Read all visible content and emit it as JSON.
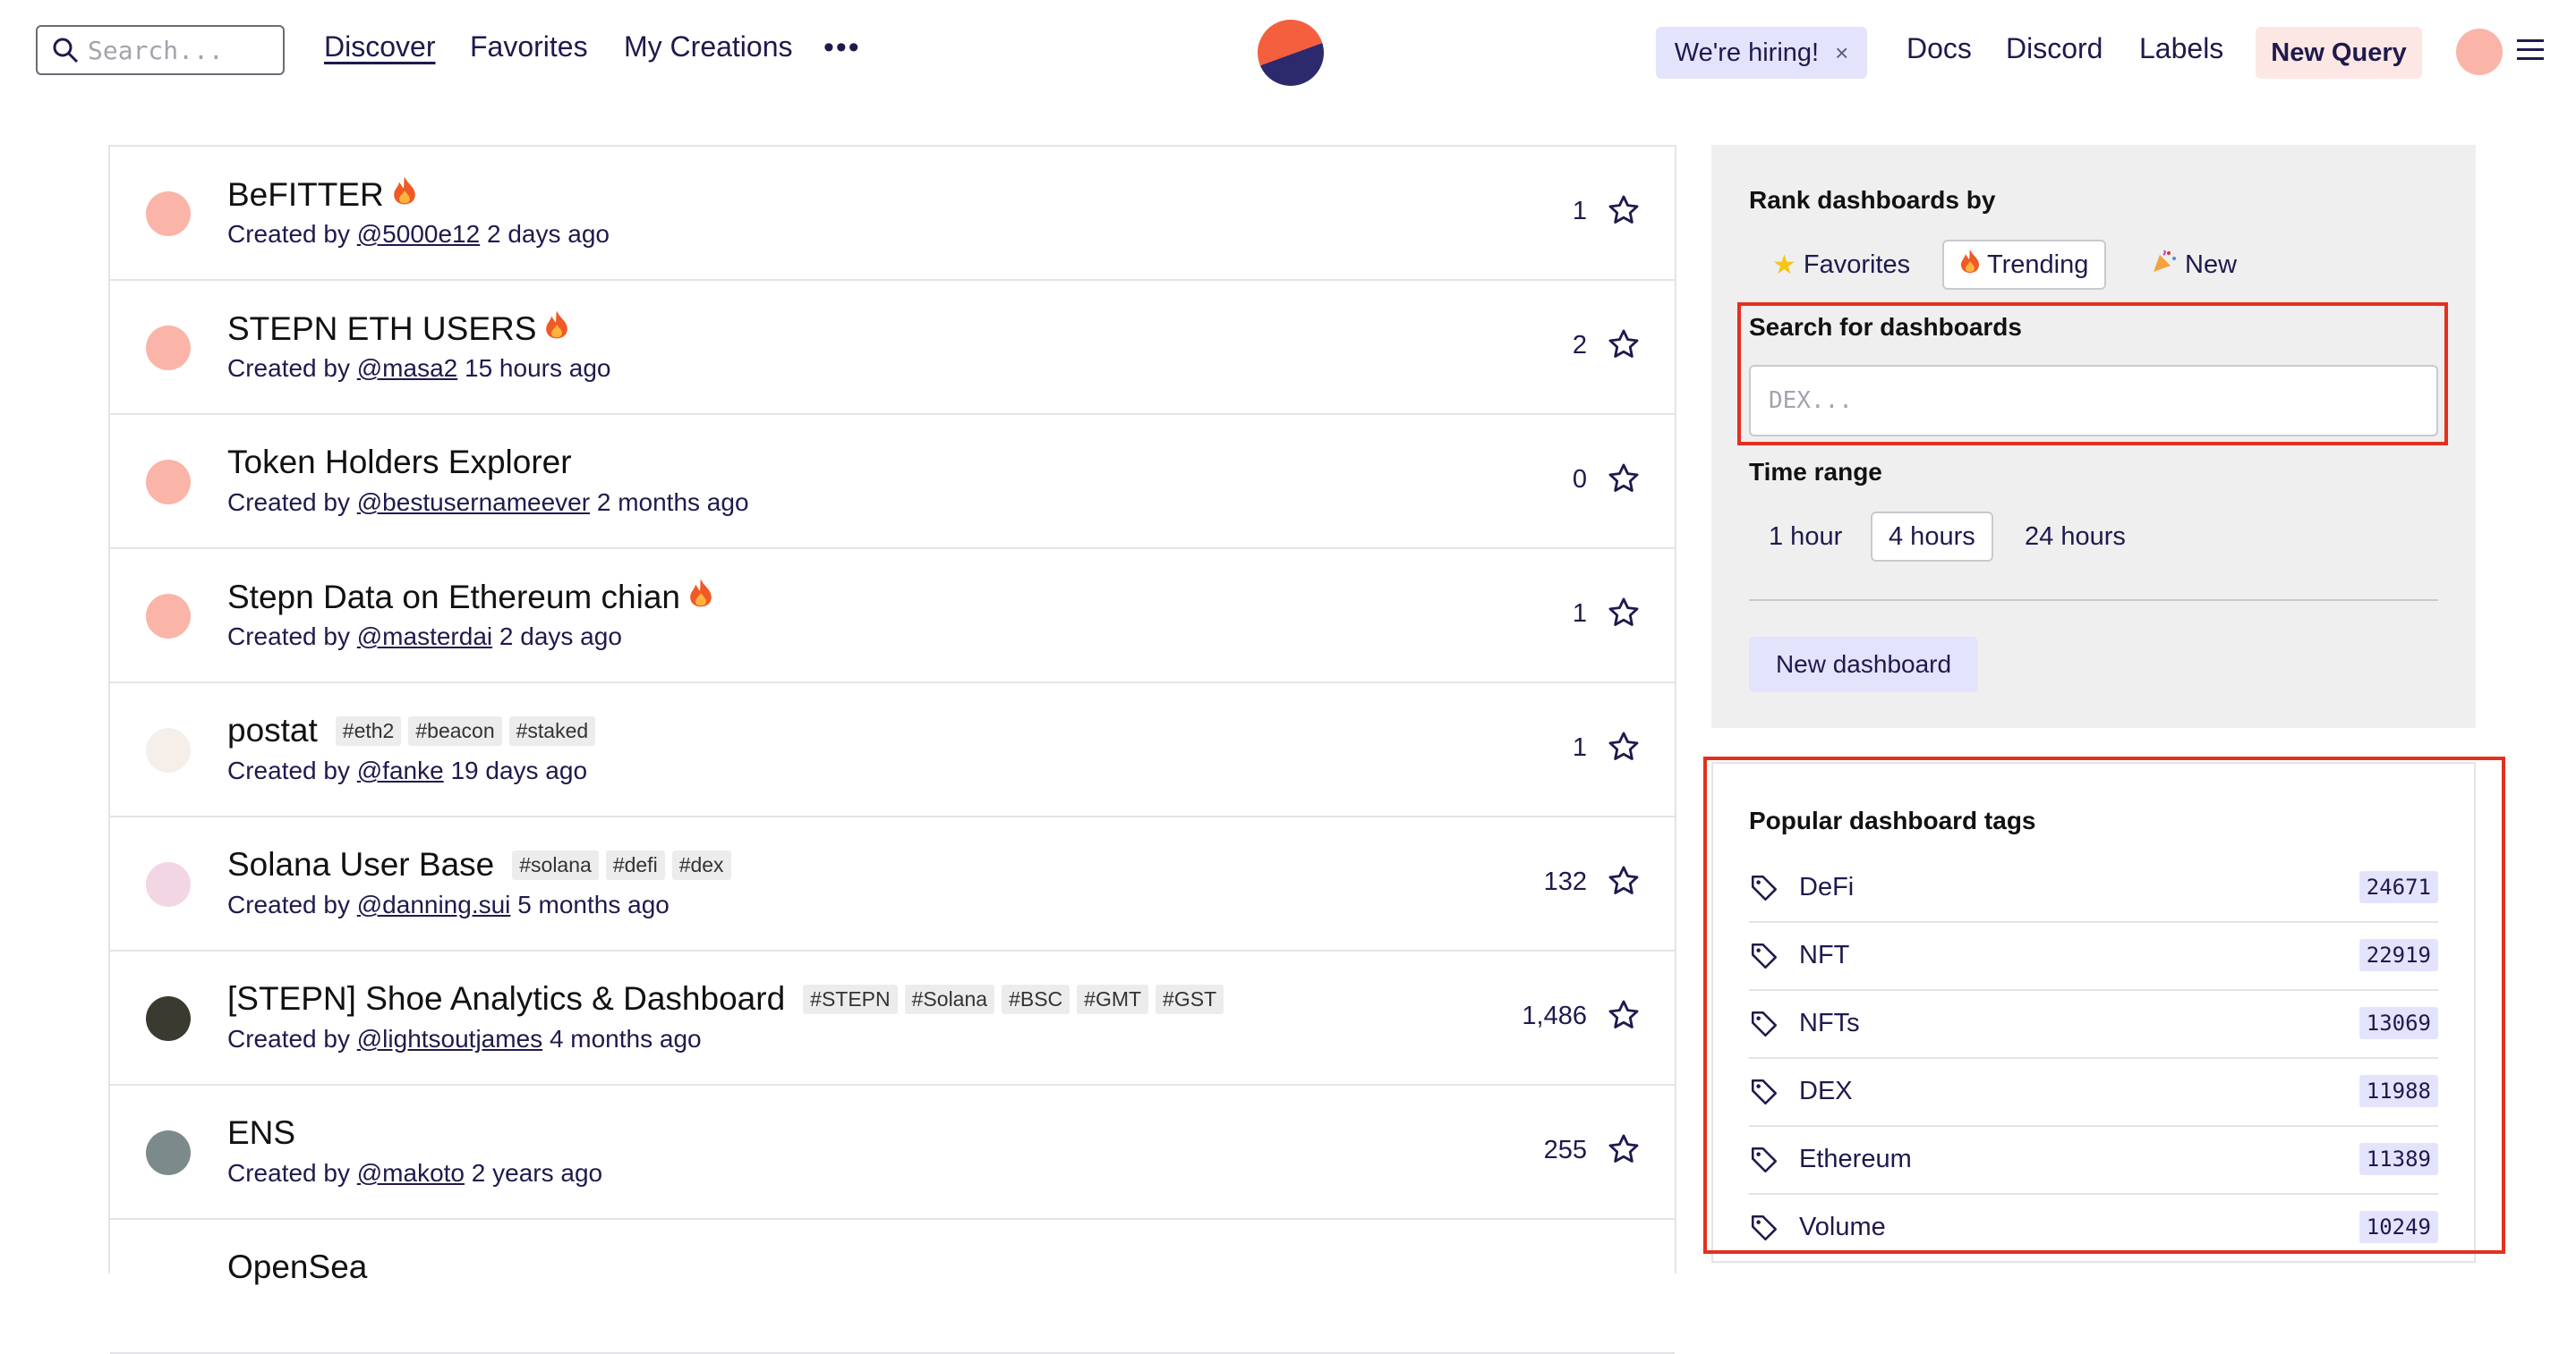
{
  "header": {
    "search_placeholder": "Search...",
    "nav": [
      "Discover",
      "Favorites",
      "My Creations"
    ],
    "more": "•••",
    "hiring": "We're hiring!",
    "hiring_close": "×",
    "links": [
      "Docs",
      "Discord",
      "Labels"
    ],
    "new_query": "New Query"
  },
  "dashboards": [
    {
      "title": "BeFITTER",
      "fire": true,
      "tags": [],
      "creator": "@5000e12",
      "age": "2 days ago",
      "favorites": "1",
      "avatar_color": "#fbb4a8"
    },
    {
      "title": "STEPN ETH USERS",
      "fire": true,
      "tags": [],
      "creator": "@masa2",
      "age": "15 hours ago",
      "favorites": "2",
      "avatar_color": "#fbb4a8"
    },
    {
      "title": "Token Holders Explorer",
      "fire": false,
      "tags": [],
      "creator": "@bestusernameever",
      "age": "2 months ago",
      "favorites": "0",
      "avatar_color": "#fbb4a8"
    },
    {
      "title": "Stepn Data on Ethereum chian",
      "fire": true,
      "tags": [],
      "creator": "@masterdai",
      "age": "2 days ago",
      "favorites": "1",
      "avatar_color": "#fbb4a8"
    },
    {
      "title": "postat",
      "fire": false,
      "tags": [
        "#eth2",
        "#beacon",
        "#staked"
      ],
      "creator": "@fanke",
      "age": "19 days ago",
      "favorites": "1",
      "avatar_color": "#f6efe9"
    },
    {
      "title": "Solana User Base",
      "fire": false,
      "tags": [
        "#solana",
        "#defi",
        "#dex"
      ],
      "creator": "@danning.sui",
      "age": "5 months ago",
      "favorites": "132",
      "avatar_color": "#f3d6e4"
    },
    {
      "title": "[STEPN] Shoe Analytics & Dashboard",
      "fire": false,
      "tags": [
        "#STEPN",
        "#Solana",
        "#BSC",
        "#GMT",
        "#GST"
      ],
      "creator": "@lightsoutjames",
      "age": "4 months ago",
      "favorites": "1,486",
      "avatar_color": "#3a3a30"
    },
    {
      "title": "ENS",
      "fire": false,
      "tags": [],
      "creator": "@makoto",
      "age": "2 years ago",
      "favorites": "255",
      "avatar_color": "#7d8a8c"
    },
    {
      "title": "OpenSea",
      "fire": false,
      "tags": [],
      "creator": "",
      "age": "",
      "favorites": "",
      "avatar_color": "#ffffff"
    }
  ],
  "created_by": "Created by",
  "sidebar": {
    "rank_heading": "Rank dashboards by",
    "rank_options": [
      "Favorites",
      "Trending",
      "New"
    ],
    "rank_selected": "Trending",
    "search_heading": "Search for dashboards",
    "search_placeholder": "DEX...",
    "time_heading": "Time range",
    "time_options": [
      "1 hour",
      "4 hours",
      "24 hours"
    ],
    "time_selected": "4 hours",
    "new_dashboard": "New dashboard",
    "tags_heading": "Popular dashboard tags",
    "tags": [
      {
        "name": "DeFi",
        "count": "24671"
      },
      {
        "name": "NFT",
        "count": "22919"
      },
      {
        "name": "NFTs",
        "count": "13069"
      },
      {
        "name": "DEX",
        "count": "11988"
      },
      {
        "name": "Ethereum",
        "count": "11389"
      },
      {
        "name": "Volume",
        "count": "10249"
      }
    ]
  },
  "colors": {
    "accent": "#e3301f",
    "text": "#1e1a4d",
    "brand_orange": "#f4603e",
    "brand_navy": "#2c2a6d"
  }
}
